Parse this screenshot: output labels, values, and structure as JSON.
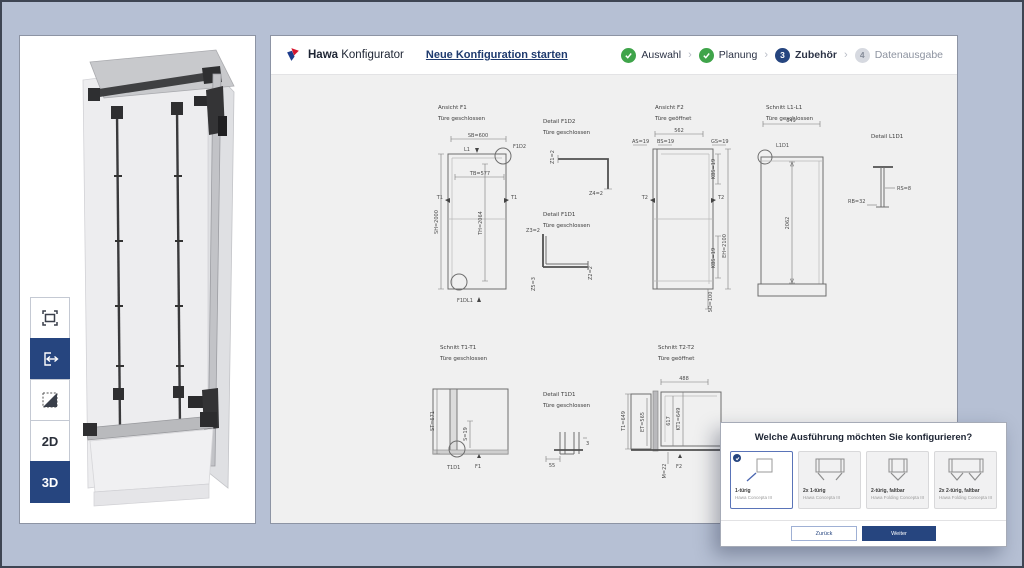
{
  "header": {
    "brand_bold": "Hawa",
    "brand_rest": " Konfigurator",
    "new_config_link": "Neue Konfiguration starten",
    "separator": "›",
    "steps": [
      {
        "label": "Auswahl",
        "state": "done"
      },
      {
        "label": "Planung",
        "state": "done"
      },
      {
        "label": "Zubehör",
        "state": "active",
        "number": "3"
      },
      {
        "label": "Datenausgabe",
        "state": "pending",
        "number": "4"
      }
    ]
  },
  "viewer": {
    "label_2d": "2D",
    "label_3d": "3D"
  },
  "drawings": {
    "f1": {
      "title": "Ansicht F1",
      "subtitle": "Türe geschlossen",
      "sb": "SB=600",
      "l1": "L1",
      "f1d2": "F1D2",
      "tb": "TB=577",
      "t1_left": "T1",
      "t1_right": "T1",
      "sh": "SH=2000",
      "th": "TH=2064",
      "f1dl1": "F1DL1"
    },
    "f1d2_detail": {
      "title": "Detail F1D2",
      "subtitle": "Türe geschlossen",
      "z1": "Z1=2",
      "z4": "Z4=2"
    },
    "f1d1_detail": {
      "title": "Detail F1D1",
      "subtitle": "Türe geschlossen",
      "z3": "Z3=2",
      "z2": "Z2=2",
      "z5": "Z5=3"
    },
    "f2": {
      "title": "Ansicht F2",
      "subtitle": "Türe geöffnet",
      "w562": "562",
      "as19": "AS=19",
      "bs": "BS=19",
      "gs": "GS=19",
      "kbs_top": "KBS=19",
      "kbs_bottom": "KBS=19",
      "t2_left": "T2",
      "t2_right": "T2",
      "eh": "EH=2100",
      "so": "SO=100"
    },
    "l1l1": {
      "title": "Schnitt L1-L1",
      "subtitle": "Türe geschlossen",
      "w649": "649",
      "l1d1": "L1D1",
      "h2062": "2062"
    },
    "l1d1_detail": {
      "title": "Detail L1D1",
      "rs": "RS=8",
      "rb": "RB=32"
    },
    "t1t1": {
      "title": "Schnitt T1-T1",
      "subtitle": "Türe geschlossen",
      "st": "ST=671",
      "s": "S=19",
      "t1d1": "T1D1",
      "f1": "F1"
    },
    "t1d1_detail": {
      "title": "Detail T1D1",
      "subtitle": "Türe geschlossen",
      "w55": "55",
      "t3": "3"
    },
    "t2t2": {
      "title": "Schnitt T2-T2",
      "subtitle": "Türe geöffnet",
      "w488": "488",
      "t1": "T1=649",
      "et": "ET=565",
      "d617": "617",
      "kt1": "KT1=649",
      "m": "M=22",
      "f2": "F2"
    }
  },
  "dialog": {
    "title": "Welche Ausführung möchten Sie konfigurieren?",
    "options": [
      {
        "label": "1-türig",
        "sub": "Hawa Concepta III",
        "selected": true
      },
      {
        "label": "2x 1-türig",
        "sub": "Hawa Concepta III",
        "selected": false
      },
      {
        "label": "2-türig, faltbar",
        "sub": "Hawa Folding Concepta III",
        "selected": false
      },
      {
        "label": "2x 2-türig, faltbar",
        "sub": "Hawa Folding Concepta III",
        "selected": false
      }
    ],
    "back_label": "Zurück",
    "next_label": "Weiter"
  },
  "colors": {
    "accent_navy": "#26457f",
    "done_green": "#3fa44a",
    "selected_border": "#5a74b8"
  }
}
